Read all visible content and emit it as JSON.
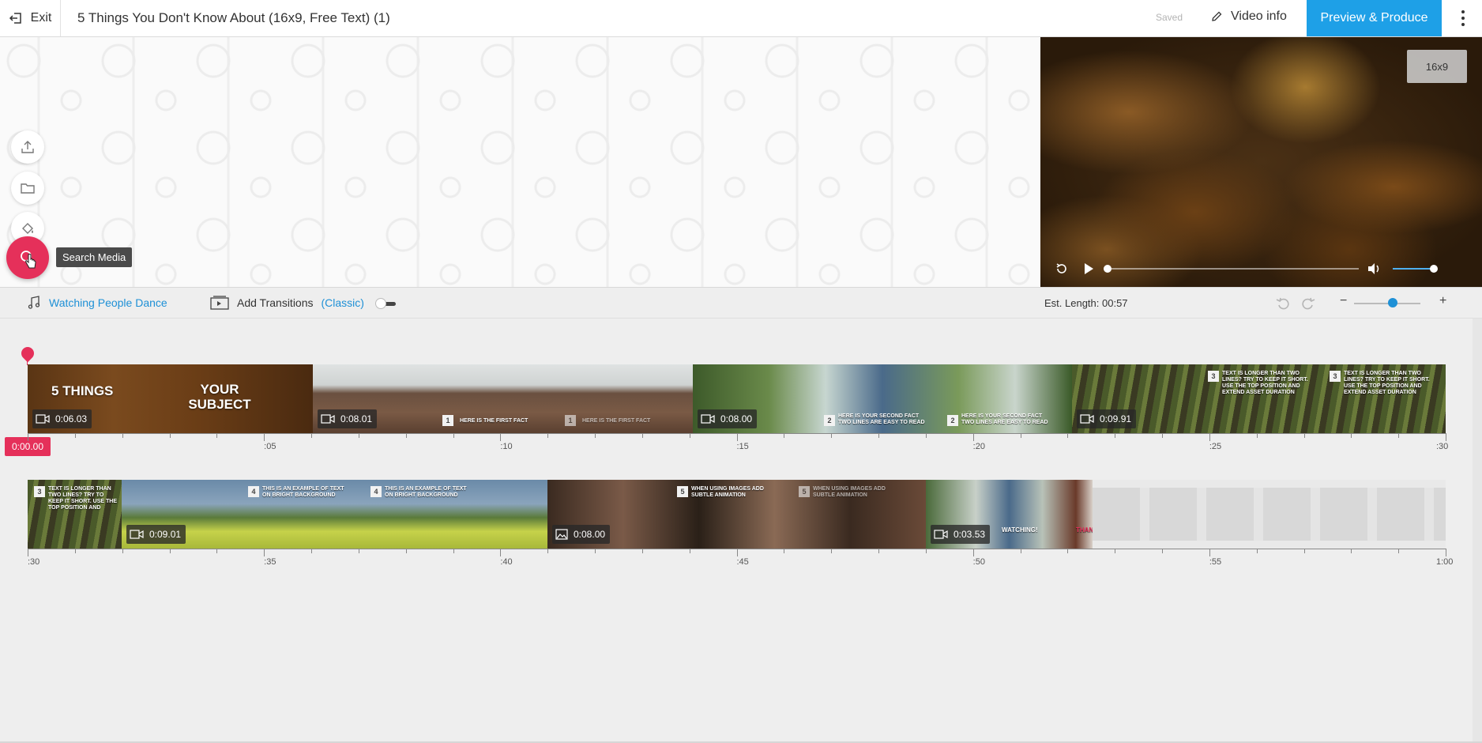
{
  "header": {
    "exit_label": "Exit",
    "title": "5 Things You Don't Know About (16x9, Free Text) (1)",
    "saved_label": "Saved",
    "video_info_label": "Video info",
    "preview_label": "Preview & Produce"
  },
  "workspace": {
    "tooltip": "Search Media",
    "tools": [
      "upload-icon",
      "folder-icon",
      "paint-bucket-icon",
      "search-media-icon"
    ]
  },
  "preview": {
    "aspect_label": "16x9",
    "seek_fraction": 0.0,
    "volume_fraction": 1.0
  },
  "toolbar": {
    "music_label": "Watching People Dance",
    "transitions_label": "Add Transitions",
    "transitions_mode": "(Classic)",
    "transitions_enabled": false,
    "est_length": "Est. Length: 00:57",
    "zoom_fraction": 0.5
  },
  "timeline": {
    "playhead_time": "0:00.00",
    "row1_ruler": [
      ":05",
      ":10",
      ":15",
      ":20",
      ":25",
      ":30"
    ],
    "row2_ruler": [
      ":30",
      ":35",
      ":40",
      ":45",
      ":50",
      ":55",
      "1:00"
    ],
    "row1_clips": [
      {
        "duration": "0:06.03",
        "title_left": "5 THINGS",
        "title_right": "YOUR SUBJECT",
        "type": "video"
      },
      {
        "duration": "0:08.01",
        "num": "1",
        "caption": "HERE IS THE FIRST FACT",
        "type": "video"
      },
      {
        "duration": "0:08.00",
        "num": "2",
        "caption": "HERE IS YOUR SECOND FACT TWO LINES ARE EASY TO READ",
        "type": "video"
      },
      {
        "duration": "0:09.91",
        "num": "3",
        "caption": "TEXT IS LONGER THAN TWO LINES? TRY TO KEEP IT SHORT. USE THE TOP POSITION AND EXTEND ASSET DURATION",
        "type": "video"
      }
    ],
    "row2_clips": [
      {
        "duration": "",
        "num": "3",
        "caption": "TEXT IS LONGER THAN TWO LINES? TRY TO KEEP IT SHORT. USE THE TOP POSITION AND EXTEND ASSET DURATION",
        "type": "video"
      },
      {
        "duration": "0:09.01",
        "num": "4",
        "caption": "THIS IS AN EXAMPLE OF TEXT ON BRIGHT BACKGROUND",
        "type": "video"
      },
      {
        "duration": "0:08.00",
        "num": "5",
        "caption": "WHEN USING IMAGES ADD SUBTLE ANIMATION",
        "type": "image"
      },
      {
        "duration": "0:03.53",
        "caption_a": "WATCHING!",
        "caption_b": "THAN",
        "type": "video"
      }
    ]
  }
}
